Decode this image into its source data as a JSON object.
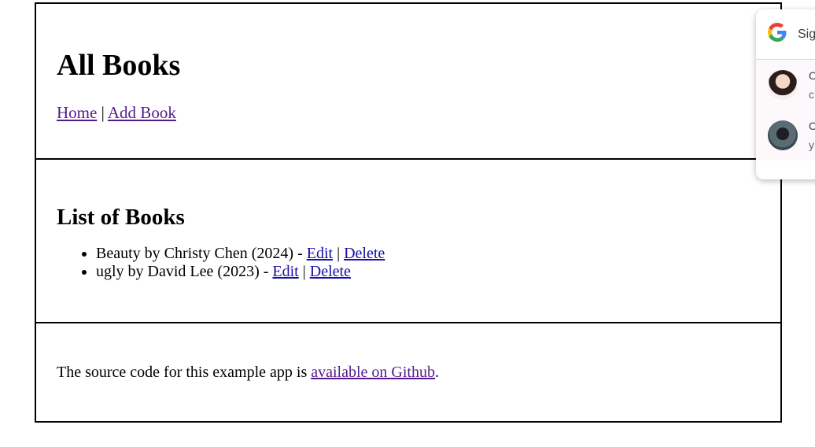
{
  "header": {
    "title": "All Books",
    "nav": {
      "home": "Home",
      "separator": "|",
      "add_book": "Add Book"
    }
  },
  "list": {
    "heading": "List of Books",
    "edit_label": "Edit",
    "delete_label": "Delete",
    "separator": "|",
    "items": [
      {
        "text": "Beauty by Christy Chen (2024) - "
      },
      {
        "text": "ugly by David Lee (2023) - "
      }
    ]
  },
  "footer": {
    "text": "The source code for this example app is ",
    "link": "available on Github",
    "end": "."
  },
  "google_popup": {
    "title": "Sig",
    "accounts": [
      {
        "name": "C",
        "email": "c"
      },
      {
        "name": "C",
        "email": "y"
      }
    ]
  }
}
